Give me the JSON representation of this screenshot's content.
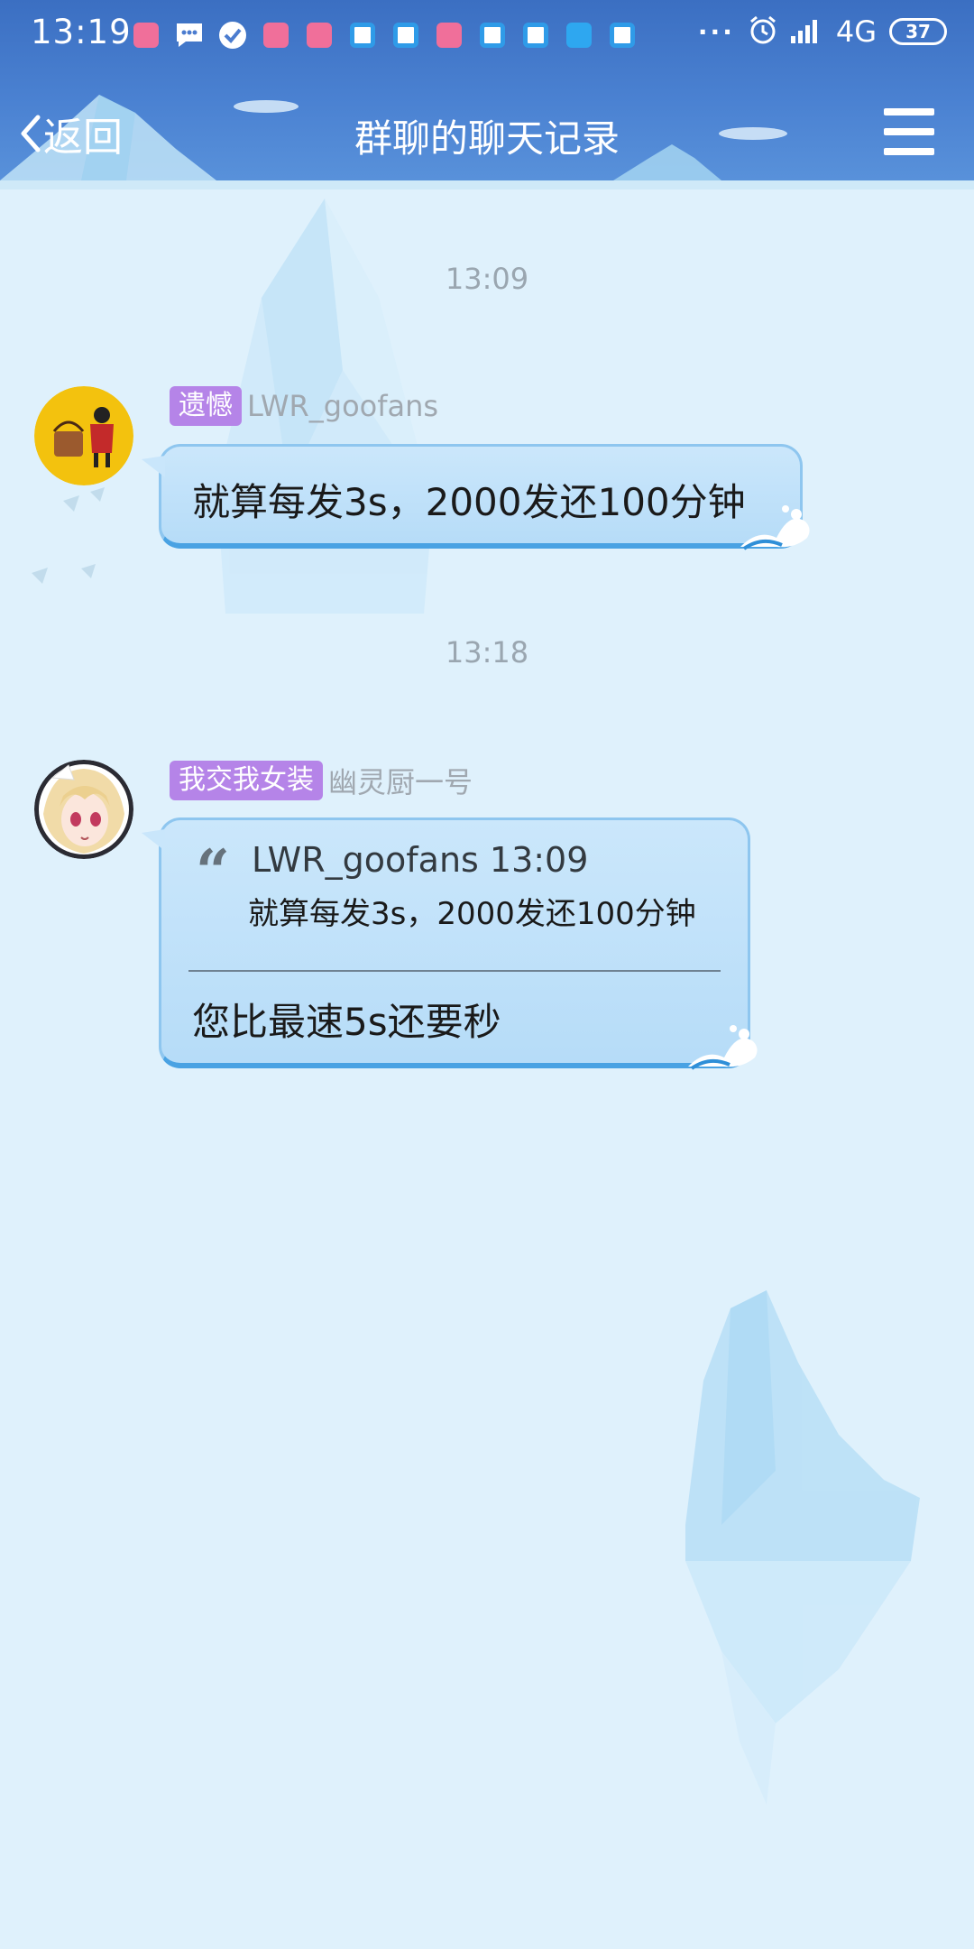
{
  "status_bar": {
    "time": "13:19",
    "overflow_dots": "···",
    "network": "4G",
    "battery": "37",
    "notification_icons": [
      "lofter-icon",
      "message-icon",
      "check-icon",
      "lofter-icon",
      "lofter-icon",
      "qq-browser-icon",
      "qq-browser-icon",
      "lofter-icon",
      "qq-browser-icon",
      "qq-browser-icon",
      "document-icon",
      "qq-browser-icon"
    ]
  },
  "nav": {
    "back_label": "返回",
    "title": "群聊的聊天记录"
  },
  "messages": [
    {
      "timestamp": "13:09",
      "badge": "遗憾",
      "sender": "LWR_goofans",
      "text": "就算每发3s，2000发还100分钟"
    },
    {
      "timestamp": "13:18",
      "badge": "我交我女装",
      "sender": "幽灵厨一号",
      "quote": {
        "mark": "“",
        "header": "LWR_goofans 13:09",
        "text": "就算每发3s，2000发还100分钟"
      },
      "text": "您比最速5s还要秒"
    }
  ],
  "colors": {
    "header": "#4b82d2",
    "background": "#dff1fc",
    "bubble": "#b6dcf8",
    "badge": "#b584e8"
  }
}
